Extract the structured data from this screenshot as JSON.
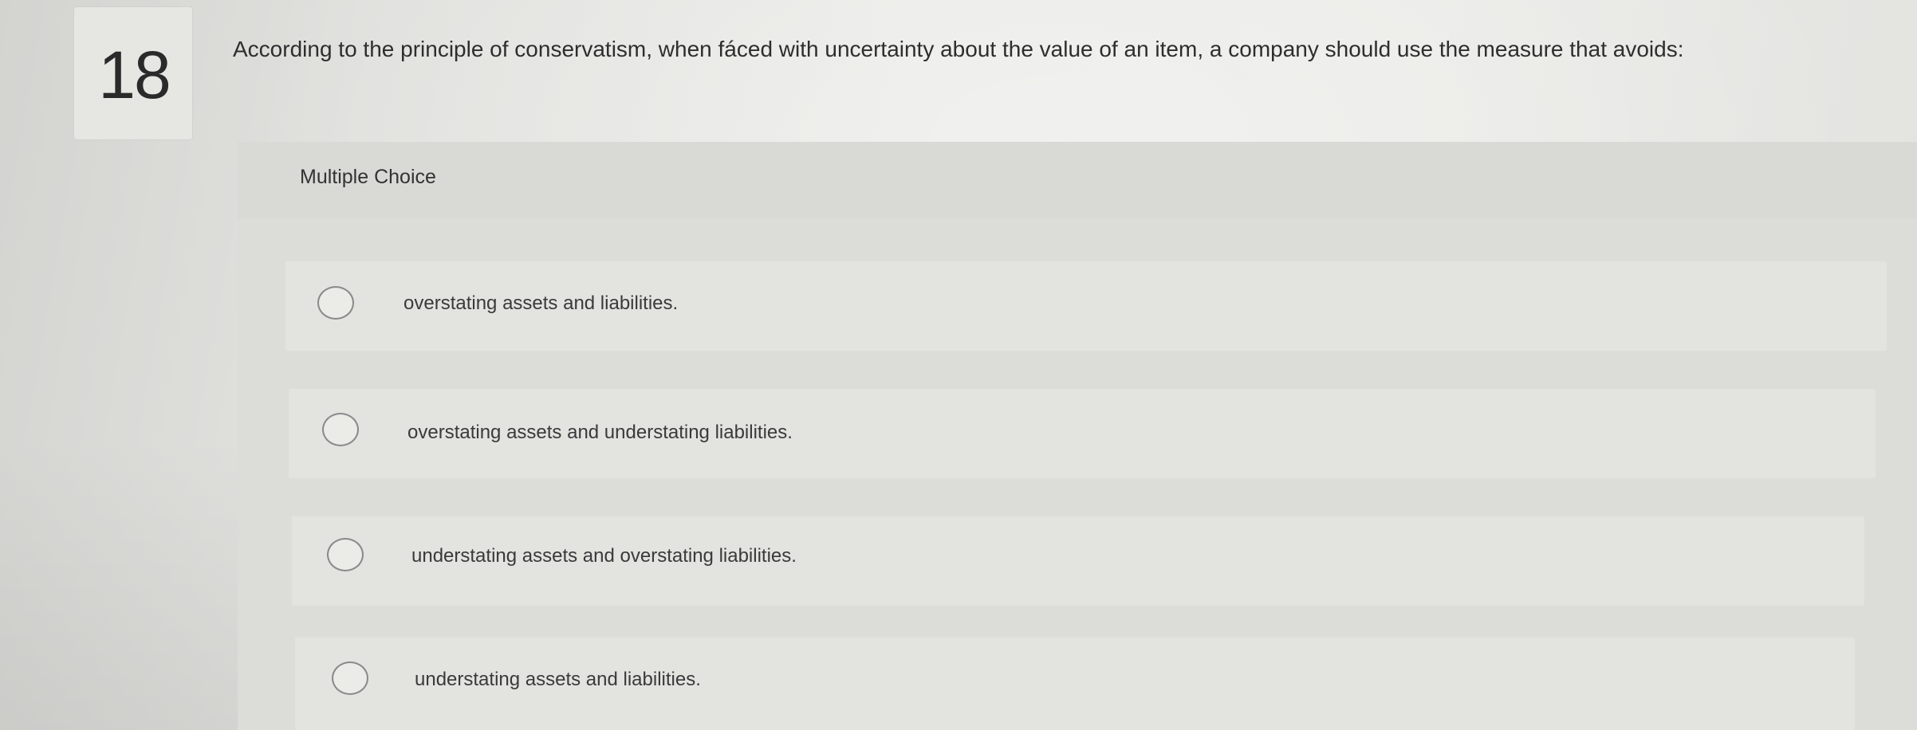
{
  "question": {
    "number": "18",
    "prompt": "According to the principle of conservatism, when fáced with uncertainty about the value of an item, a company should use the measure that avoids:"
  },
  "answer_panel": {
    "type_label": "Multiple Choice",
    "options": [
      {
        "label": "overstating assets and liabilities."
      },
      {
        "label": "overstating assets and understating liabilities."
      },
      {
        "label": "understating assets and overstating liabilities."
      },
      {
        "label": "understating assets and liabilities."
      }
    ]
  }
}
